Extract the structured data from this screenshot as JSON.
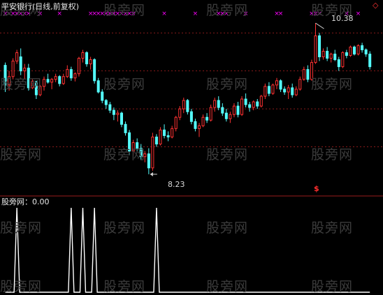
{
  "header": {
    "title": "平安银行(日线,前复权)",
    "diamond_glyph": "◇"
  },
  "main_chart": {
    "type": "candlestick",
    "high_annotation": "10.38",
    "low_annotation": "8.23",
    "signal_marker": "$",
    "colors": {
      "up": "#ff3232",
      "down": "#54ffff",
      "grid": "#8a1a1a",
      "signal": "#ff2e2e",
      "cross": "#ff00ff"
    }
  },
  "sub_chart": {
    "title": "股旁网：0.00",
    "colors": {
      "line": "#ffffff"
    }
  },
  "watermark": "股旁网",
  "chart_data": [
    {
      "type": "candlestick",
      "candles": [
        [
          9.78,
          9.82,
          9.4,
          9.5
        ],
        [
          9.5,
          9.7,
          9.42,
          9.62
        ],
        [
          9.62,
          9.88,
          9.58,
          9.84
        ],
        [
          9.84,
          10.0,
          9.8,
          9.96
        ],
        [
          9.9,
          10.02,
          9.64,
          9.7
        ],
        [
          9.7,
          9.8,
          9.58,
          9.74
        ],
        [
          9.74,
          9.8,
          9.42,
          9.46
        ],
        [
          9.46,
          9.58,
          9.44,
          9.55
        ],
        [
          9.55,
          9.56,
          9.3,
          9.36
        ],
        [
          9.36,
          9.5,
          9.34,
          9.48
        ],
        [
          9.48,
          9.62,
          9.42,
          9.58
        ],
        [
          9.58,
          9.66,
          9.52,
          9.54
        ],
        [
          9.54,
          9.6,
          9.44,
          9.58
        ],
        [
          9.58,
          9.66,
          9.54,
          9.62
        ],
        [
          9.62,
          9.64,
          9.48,
          9.52
        ],
        [
          9.52,
          9.66,
          9.5,
          9.62
        ],
        [
          9.62,
          9.78,
          9.6,
          9.72
        ],
        [
          9.72,
          9.76,
          9.56,
          9.6
        ],
        [
          9.6,
          9.68,
          9.55,
          9.66
        ],
        [
          9.66,
          9.9,
          9.62,
          9.88
        ],
        [
          9.88,
          10.0,
          9.82,
          9.96
        ],
        [
          9.96,
          9.98,
          9.76,
          9.8
        ],
        [
          9.8,
          9.9,
          9.72,
          9.86
        ],
        [
          9.86,
          9.88,
          9.52,
          9.56
        ],
        [
          9.56,
          9.6,
          9.38,
          9.4
        ],
        [
          9.4,
          9.44,
          9.24,
          9.28
        ],
        [
          9.28,
          9.3,
          9.16,
          9.22
        ],
        [
          9.22,
          9.26,
          9.1,
          9.14
        ],
        [
          9.14,
          9.18,
          9.0,
          9.08
        ],
        [
          9.08,
          9.14,
          8.98,
          9.1
        ],
        [
          9.1,
          9.12,
          8.9,
          8.94
        ],
        [
          8.94,
          8.98,
          8.78,
          8.82
        ],
        [
          8.82,
          8.86,
          8.5,
          8.56
        ],
        [
          8.56,
          8.72,
          8.5,
          8.68
        ],
        [
          8.68,
          8.74,
          8.54,
          8.6
        ],
        [
          8.6,
          8.66,
          8.44,
          8.48
        ],
        [
          8.48,
          8.56,
          8.4,
          8.52
        ],
        [
          8.52,
          8.6,
          8.23,
          8.32
        ],
        [
          8.32,
          8.82,
          8.28,
          8.76
        ],
        [
          8.76,
          8.8,
          8.62,
          8.66
        ],
        [
          8.66,
          8.9,
          8.64,
          8.86
        ],
        [
          8.86,
          8.94,
          8.74,
          8.78
        ],
        [
          8.78,
          8.84,
          8.7,
          8.76
        ],
        [
          8.76,
          8.92,
          8.74,
          8.88
        ],
        [
          8.88,
          9.06,
          8.84,
          9.04
        ],
        [
          9.04,
          9.2,
          9.0,
          9.16
        ],
        [
          9.16,
          9.32,
          9.1,
          9.28
        ],
        [
          9.28,
          9.3,
          9.08,
          9.12
        ],
        [
          9.12,
          9.16,
          8.94,
          8.98
        ],
        [
          8.98,
          9.02,
          8.84,
          8.88
        ],
        [
          8.88,
          8.96,
          8.76,
          8.92
        ],
        [
          8.92,
          9.08,
          8.9,
          9.04
        ],
        [
          9.04,
          9.1,
          8.96,
          9.0
        ],
        [
          9.0,
          9.22,
          8.98,
          9.18
        ],
        [
          9.18,
          9.32,
          9.12,
          9.28
        ],
        [
          9.28,
          9.34,
          9.14,
          9.18
        ],
        [
          9.18,
          9.24,
          9.06,
          9.1
        ],
        [
          9.1,
          9.16,
          8.98,
          9.02
        ],
        [
          9.02,
          9.12,
          8.96,
          9.08
        ],
        [
          9.08,
          9.24,
          9.04,
          9.2
        ],
        [
          9.2,
          9.26,
          9.04,
          9.08
        ],
        [
          9.08,
          9.34,
          9.06,
          9.3
        ],
        [
          9.3,
          9.38,
          9.18,
          9.22
        ],
        [
          9.22,
          9.26,
          9.12,
          9.18
        ],
        [
          9.18,
          9.28,
          9.14,
          9.26
        ],
        [
          9.26,
          9.3,
          9.16,
          9.2
        ],
        [
          9.2,
          9.36,
          9.18,
          9.34
        ],
        [
          9.34,
          9.52,
          9.3,
          9.48
        ],
        [
          9.48,
          9.54,
          9.34,
          9.38
        ],
        [
          9.38,
          9.52,
          9.36,
          9.5
        ],
        [
          9.5,
          9.6,
          9.44,
          9.56
        ],
        [
          9.56,
          9.58,
          9.4,
          9.44
        ],
        [
          9.44,
          9.48,
          9.36,
          9.4
        ],
        [
          9.4,
          9.5,
          9.3,
          9.46
        ],
        [
          9.46,
          9.52,
          9.32,
          9.36
        ],
        [
          9.36,
          9.48,
          9.34,
          9.44
        ],
        [
          9.44,
          9.62,
          9.42,
          9.58
        ],
        [
          9.58,
          9.76,
          9.56,
          9.72
        ],
        [
          9.72,
          9.78,
          9.54,
          9.58
        ],
        [
          9.58,
          9.86,
          9.56,
          9.82
        ],
        [
          9.82,
          10.38,
          9.8,
          10.2
        ],
        [
          10.2,
          10.24,
          9.84,
          9.9
        ],
        [
          9.9,
          10.02,
          9.86,
          9.98
        ],
        [
          9.98,
          10.04,
          9.84,
          9.88
        ],
        [
          9.88,
          9.96,
          9.82,
          9.94
        ],
        [
          9.94,
          10.0,
          9.84,
          9.86
        ],
        [
          9.86,
          9.9,
          9.7,
          9.76
        ],
        [
          9.76,
          9.98,
          9.74,
          9.96
        ],
        [
          9.96,
          10.0,
          9.88,
          9.92
        ],
        [
          9.92,
          10.06,
          9.9,
          10.04
        ],
        [
          10.04,
          10.06,
          9.92,
          9.94
        ],
        [
          9.94,
          10.08,
          9.92,
          10.06
        ],
        [
          10.06,
          10.1,
          9.96,
          10.0
        ],
        [
          10.0,
          10.02,
          9.9,
          9.94
        ],
        [
          9.94,
          9.98,
          9.72,
          9.76
        ]
      ],
      "y_range": [
        8.05,
        10.55
      ],
      "grid_levels": [
        10.24,
        9.7,
        9.16,
        8.62
      ],
      "high": 10.38,
      "low": 8.23,
      "cross_marker_groups": [
        [
          0,
          1,
          2,
          3,
          4,
          5,
          6
        ],
        [
          9
        ],
        [
          14
        ],
        [
          22,
          23,
          24,
          25,
          26,
          27,
          28,
          29,
          30,
          31,
          32,
          33
        ],
        [
          41
        ],
        [
          49
        ],
        [
          55,
          56,
          57
        ],
        [
          62
        ],
        [
          70,
          71
        ],
        [
          79,
          80,
          81
        ],
        [
          88
        ],
        [
          91
        ]
      ]
    },
    {
      "type": "line",
      "series": [
        {
          "values": [
            0,
            0,
            0,
            1,
            0,
            0,
            0,
            0,
            0,
            0,
            0,
            0,
            0,
            0,
            0,
            0,
            0,
            1,
            0,
            0,
            1,
            0,
            0,
            1,
            0,
            0,
            0,
            0,
            0,
            0,
            0,
            0,
            0,
            0,
            0,
            0,
            0,
            0,
            0,
            1,
            0,
            0,
            0,
            0,
            0,
            0,
            0,
            0,
            0,
            0,
            0,
            0,
            0,
            0,
            0,
            0,
            0,
            0,
            0,
            0,
            0,
            0,
            0,
            0,
            0,
            0,
            0,
            0,
            0,
            0,
            0,
            0,
            0,
            0,
            0,
            0,
            0,
            0,
            0,
            0,
            0,
            0,
            0,
            0,
            0,
            0,
            0,
            0,
            0,
            0,
            0,
            0,
            0,
            0,
            0
          ]
        }
      ],
      "y_range": [
        0,
        1
      ]
    }
  ]
}
